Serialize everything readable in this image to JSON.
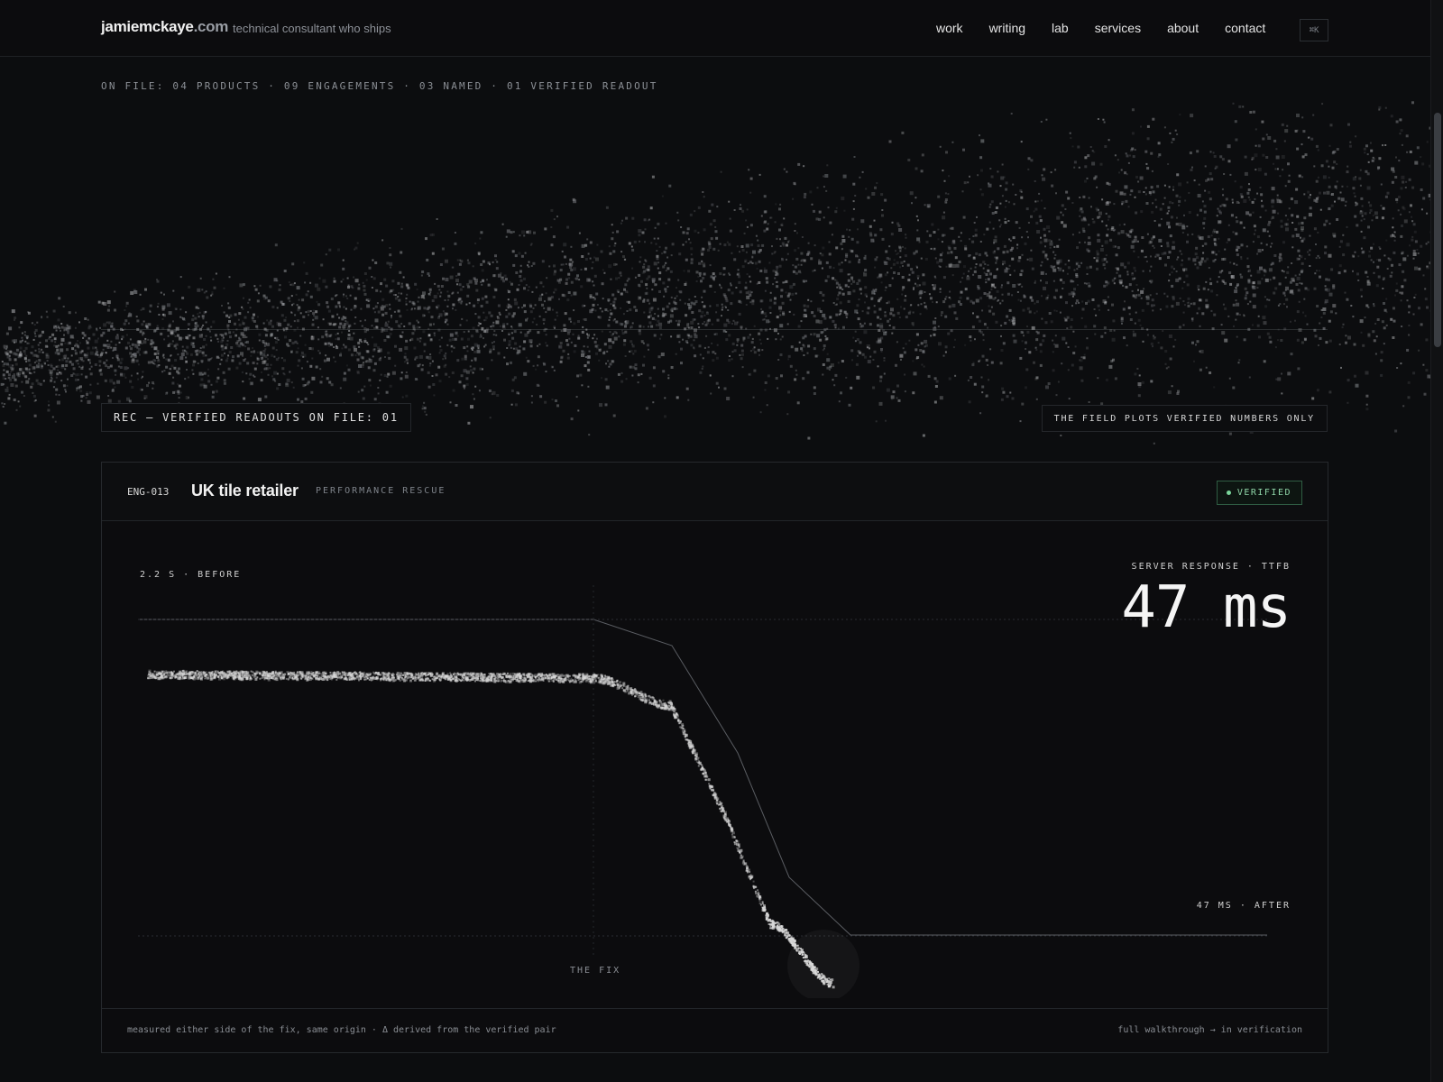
{
  "header": {
    "brand_name": "jamiemckaye",
    "brand_tld": ".com",
    "tagline": "technical consultant who ships",
    "nav": [
      "work",
      "writing",
      "lab",
      "services",
      "about",
      "contact"
    ],
    "cmdk_label": "⌘K"
  },
  "stats_line": "ON FILE: 04 PRODUCTS · 09 ENGAGEMENTS · 03 NAMED · 01 VERIFIED READOUT",
  "rec_label": "REC — VERIFIED READOUTS ON FILE: 01",
  "field_note": "THE FIELD PLOTS VERIFIED NUMBERS ONLY",
  "card": {
    "id": "ENG-013",
    "client": "UK tile retailer",
    "type": "PERFORMANCE RESCUE",
    "badge": "VERIFIED",
    "metric_label": "SERVER RESPONSE · TTFB",
    "metric_value": "47 ms",
    "before_label": "2.2 S · BEFORE",
    "after_label": "47 MS · AFTER",
    "fix_label": "THE FIX",
    "footer_left": "measured either side of the fix, same origin · Δ derived from the verified pair",
    "footer_right": "full walkthrough → in verification"
  },
  "colors": {
    "background": "#0c0d0f",
    "verified_green": "#8fd6a8",
    "particle": "#a8a8a8"
  },
  "chart_data": {
    "type": "line",
    "title": "",
    "xlabel": "",
    "ylabel": "",
    "series": [
      {
        "before_ms": 2200,
        "after_ms": 47
      }
    ],
    "annotations": [
      "2.2 S · BEFORE",
      "47 MS · AFTER",
      "THE FIX"
    ]
  },
  "scroll": {
    "thumb_fraction": 0.22
  }
}
